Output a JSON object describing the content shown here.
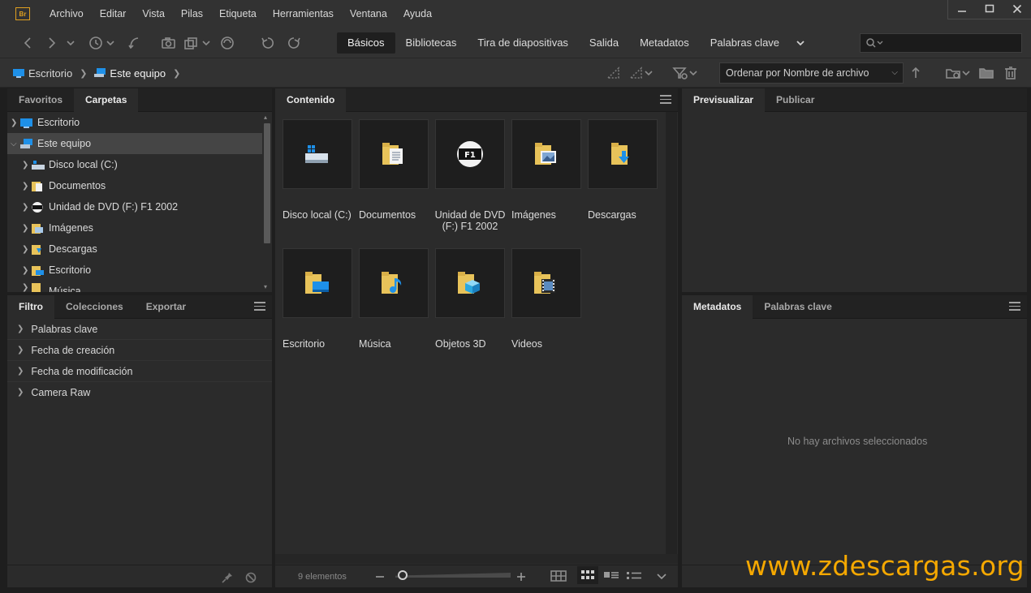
{
  "app": {
    "logo_text": "Br"
  },
  "menu": [
    "Archivo",
    "Editar",
    "Vista",
    "Pilas",
    "Etiqueta",
    "Herramientas",
    "Ventana",
    "Ayuda"
  ],
  "workspaces": [
    "Básicos",
    "Bibliotecas",
    "Tira de diapositivas",
    "Salida",
    "Metadatos",
    "Palabras clave"
  ],
  "search": {
    "value": ""
  },
  "path": {
    "items": [
      "Escritorio",
      "Este equipo"
    ]
  },
  "sort": {
    "label": "Ordenar por Nombre de archivo"
  },
  "left_top_tabs": [
    "Favoritos",
    "Carpetas"
  ],
  "tree": [
    {
      "label": "Escritorio",
      "icon": "desktop-icon",
      "level": 0
    },
    {
      "label": "Este equipo",
      "icon": "computer-icon",
      "level": 0,
      "expanded": true,
      "selected": true
    },
    {
      "label": "Disco local (C:)",
      "icon": "drive-icon",
      "level": 1
    },
    {
      "label": "Documentos",
      "icon": "documents-folder-icon",
      "level": 1
    },
    {
      "label": "Unidad de DVD (F:) F1 2002",
      "icon": "dvd-icon",
      "level": 1
    },
    {
      "label": "Imágenes",
      "icon": "pictures-folder-icon",
      "level": 1
    },
    {
      "label": "Descargas",
      "icon": "downloads-folder-icon",
      "level": 1
    },
    {
      "label": "Escritorio",
      "icon": "desktop-folder-icon",
      "level": 1
    },
    {
      "label": "Música",
      "icon": "music-folder-icon",
      "level": 1
    }
  ],
  "left_bottom_tabs": [
    "Filtro",
    "Colecciones",
    "Exportar"
  ],
  "filters": [
    "Palabras clave",
    "Fecha de creación",
    "Fecha de modificación",
    "Camera Raw"
  ],
  "content": {
    "tab": "Contenido",
    "items": [
      {
        "label": "Disco local (C:)",
        "icon": "drive-icon"
      },
      {
        "label": "Documentos",
        "icon": "documents-folder-icon"
      },
      {
        "label": "Unidad de DVD (F:) F1 2002",
        "icon": "dvd-icon"
      },
      {
        "label": "Imágenes",
        "icon": "pictures-folder-icon"
      },
      {
        "label": "Descargas",
        "icon": "downloads-folder-icon"
      },
      {
        "label": "Escritorio",
        "icon": "desktop-folder-icon"
      },
      {
        "label": "Música",
        "icon": "music-folder-icon"
      },
      {
        "label": "Objetos 3D",
        "icon": "3d-objects-folder-icon"
      },
      {
        "label": "Videos",
        "icon": "videos-folder-icon"
      }
    ],
    "count_label": "9 elementos"
  },
  "right_top_tabs": [
    "Previsualizar",
    "Publicar"
  ],
  "right_bottom_tabs": [
    "Metadatos",
    "Palabras clave"
  ],
  "no_selection": "No hay archivos seleccionados",
  "watermark": "www.zdescargas.org",
  "colors": {
    "accent_orange": "#f5a800",
    "folder_yellow": "#e8c35a",
    "windows_blue": "#1e90e8"
  }
}
